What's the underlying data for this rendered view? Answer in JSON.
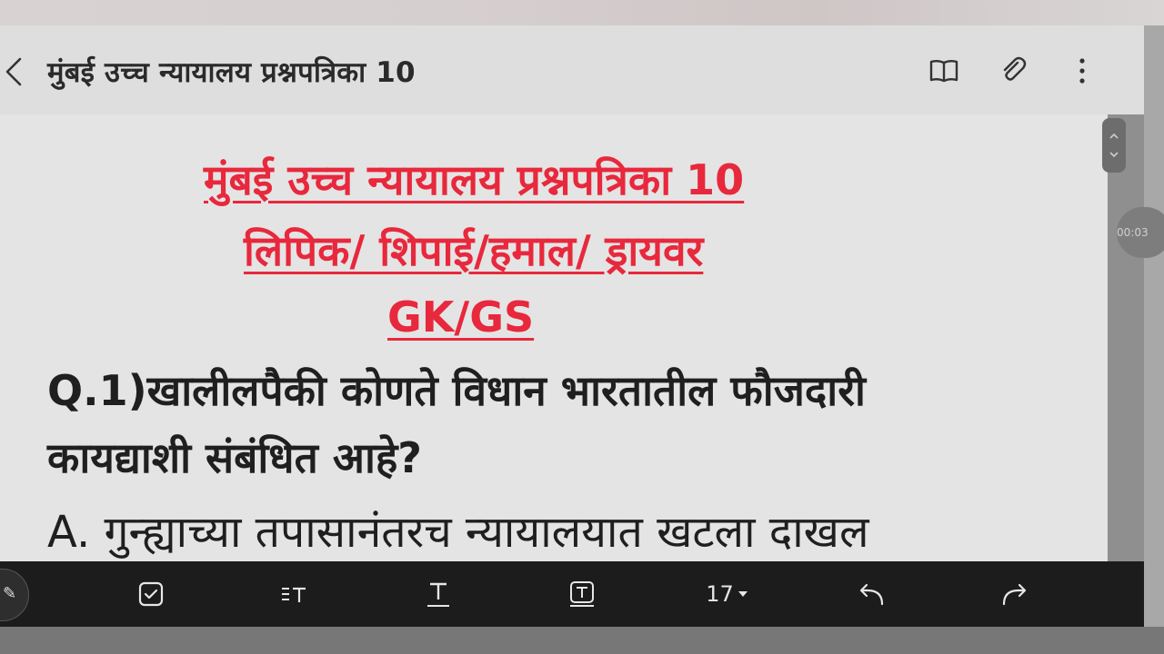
{
  "appbar": {
    "title": "मुंबई उच्च न्यायालय प्रश्नपत्रिका 10",
    "back_icon": "chevron-left-icon",
    "actions": [
      "reading-mode-icon",
      "attachment-icon",
      "more-vert-icon"
    ]
  },
  "document": {
    "heading_line1": "मुंबई उच्च न्यायालय प्रश्नपत्रिका 10",
    "heading_line2": "लिपिक/ शिपाई/हमाल/ ड्रायवर ",
    "heading_line3": "GK/GS",
    "question_line1": "Q.1)खालीलपैकी कोणते विधान भारतातील फौजदारी",
    "question_line2": "कायद्याशी संबंधित आहे?",
    "option_a": "A. गुन्ह्याच्या तपासानंतरच न्यायालयात खटला दाखल",
    "heading_color": "#e8283c"
  },
  "overlay": {
    "timer_text": "00:03"
  },
  "toolbar": {
    "font_size_label": "17",
    "icons": [
      "pen-icon",
      "checkbox-icon",
      "text-style-icon",
      "text-icon",
      "text-box-icon",
      "undo-icon",
      "redo-icon"
    ]
  }
}
